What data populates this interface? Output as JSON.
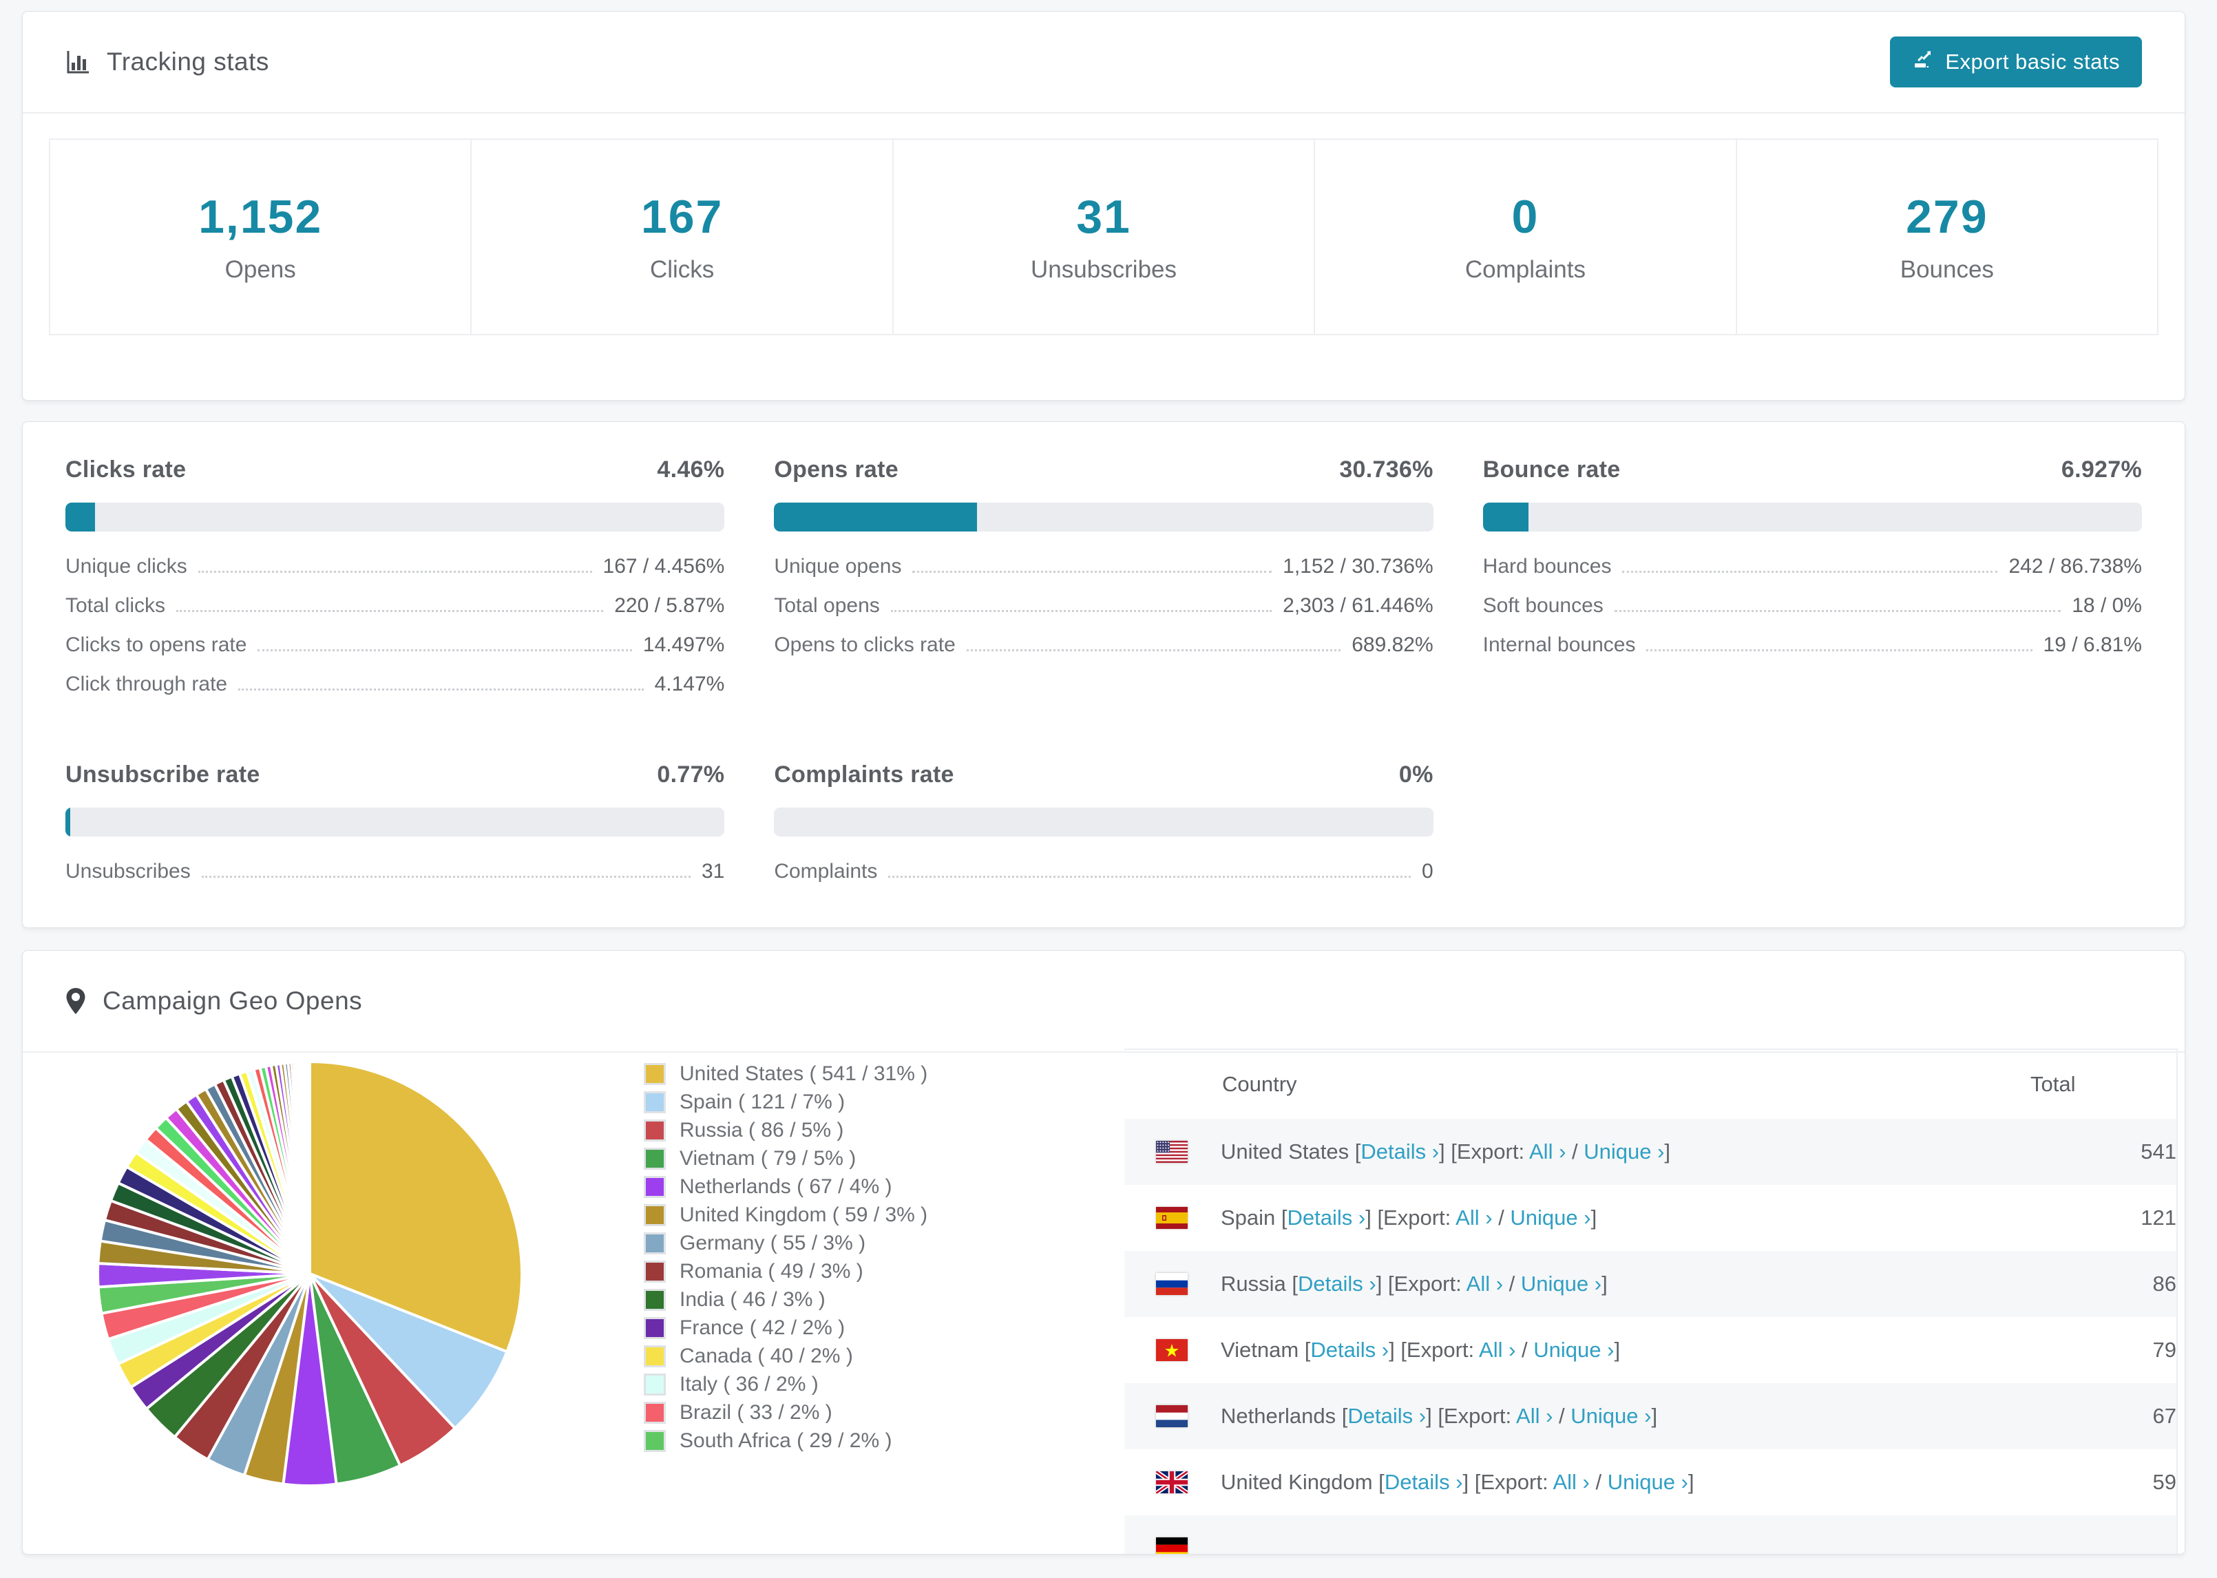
{
  "colors": {
    "accent_teal": "#1789a4",
    "link_teal": "#2f9fc4",
    "bar_track": "#eaecf0",
    "row_stripe": "#f6f7f8"
  },
  "tracking": {
    "title": "Tracking stats",
    "export_button": "Export basic stats",
    "stats": [
      {
        "value": "1,152",
        "label": "Opens"
      },
      {
        "value": "167",
        "label": "Clicks"
      },
      {
        "value": "31",
        "label": "Unsubscribes"
      },
      {
        "value": "0",
        "label": "Complaints"
      },
      {
        "value": "279",
        "label": "Bounces"
      }
    ]
  },
  "rates": [
    {
      "title": "Clicks rate",
      "value_label": "4.46%",
      "percent": 4.46,
      "rows": [
        {
          "label": "Unique clicks",
          "value": "167 / 4.456%"
        },
        {
          "label": "Total clicks",
          "value": "220 / 5.87%"
        },
        {
          "label": "Clicks to opens rate",
          "value": "14.497%"
        },
        {
          "label": "Click through rate",
          "value": "4.147%"
        }
      ]
    },
    {
      "title": "Opens rate",
      "value_label": "30.736%",
      "percent": 30.736,
      "rows": [
        {
          "label": "Unique opens",
          "value": "1,152 / 30.736%"
        },
        {
          "label": "Total opens",
          "value": "2,303 / 61.446%"
        },
        {
          "label": "Opens to clicks rate",
          "value": "689.82%"
        }
      ]
    },
    {
      "title": "Bounce rate",
      "value_label": "6.927%",
      "percent": 6.927,
      "rows": [
        {
          "label": "Hard bounces",
          "value": "242 / 86.738%"
        },
        {
          "label": "Soft bounces",
          "value": "18 / 0%"
        },
        {
          "label": "Internal bounces",
          "value": "19 / 6.81%"
        }
      ]
    },
    {
      "title": "Unsubscribe rate",
      "value_label": "0.77%",
      "percent": 0.77,
      "rows": [
        {
          "label": "Unsubscribes",
          "value": "31"
        }
      ]
    },
    {
      "title": "Complaints rate",
      "value_label": "0%",
      "percent": 0,
      "rows": [
        {
          "label": "Complaints",
          "value": "0"
        }
      ]
    }
  ],
  "geo": {
    "title": "Campaign Geo Opens",
    "table": {
      "country_header": "Country",
      "total_header": "Total",
      "details_label": "Details ›",
      "export_label": "[Export:",
      "all_label": "All ›",
      "unique_label": "Unique ›",
      "rows": [
        {
          "flag": "us",
          "country": "United States",
          "total": "541"
        },
        {
          "flag": "es",
          "country": "Spain",
          "total": "121"
        },
        {
          "flag": "ru",
          "country": "Russia",
          "total": "86"
        },
        {
          "flag": "vn",
          "country": "Vietnam",
          "total": "79"
        },
        {
          "flag": "nl",
          "country": "Netherlands",
          "total": "67"
        },
        {
          "flag": "gb",
          "country": "United Kingdom",
          "total": "59"
        },
        {
          "flag": "de",
          "country": "",
          "total": "",
          "partial": true
        }
      ]
    }
  },
  "chart_data": {
    "type": "pie",
    "title": "Campaign Geo Opens",
    "unit": "opens",
    "start_angle_deg": 0,
    "direction": "clockwise",
    "legend_position": "right",
    "slices": [
      {
        "label": "United States",
        "count": 541,
        "percent": 31,
        "color": "#e3bd3f"
      },
      {
        "label": "Spain",
        "count": 121,
        "percent": 7,
        "color": "#abd3f2"
      },
      {
        "label": "Russia",
        "count": 86,
        "percent": 5,
        "color": "#c84a4e"
      },
      {
        "label": "Vietnam",
        "count": 79,
        "percent": 5,
        "color": "#43a34e"
      },
      {
        "label": "Netherlands",
        "count": 67,
        "percent": 4,
        "color": "#9d3fee"
      },
      {
        "label": "United Kingdom",
        "count": 59,
        "percent": 3,
        "color": "#b5922c"
      },
      {
        "label": "Germany",
        "count": 55,
        "percent": 3,
        "color": "#82a8c4"
      },
      {
        "label": "Romania",
        "count": 49,
        "percent": 3,
        "color": "#9c3a39"
      },
      {
        "label": "India",
        "count": 46,
        "percent": 3,
        "color": "#30762f"
      },
      {
        "label": "France",
        "count": 42,
        "percent": 2,
        "color": "#6a2ca9"
      },
      {
        "label": "Canada",
        "count": 40,
        "percent": 2,
        "color": "#f7e14a"
      },
      {
        "label": "Italy",
        "count": 36,
        "percent": 2,
        "color": "#d8fdf6"
      },
      {
        "label": "Brazil",
        "count": 33,
        "percent": 2,
        "color": "#f4606b"
      },
      {
        "label": "South Africa",
        "count": 29,
        "percent": 2,
        "color": "#5fc863"
      }
    ],
    "others": {
      "note": "many small unlabeled country slices fanning to hairline width",
      "total_percent": 26,
      "count": 48,
      "palette": [
        "#9a45ec",
        "#a3862a",
        "#5d7f9c",
        "#8d3434",
        "#1d5c31",
        "#342a7a",
        "#f7f445",
        "#e9fffb",
        "#f55f5f",
        "#57dd6d",
        "#d44ae0",
        "#8a7a1e"
      ]
    }
  }
}
